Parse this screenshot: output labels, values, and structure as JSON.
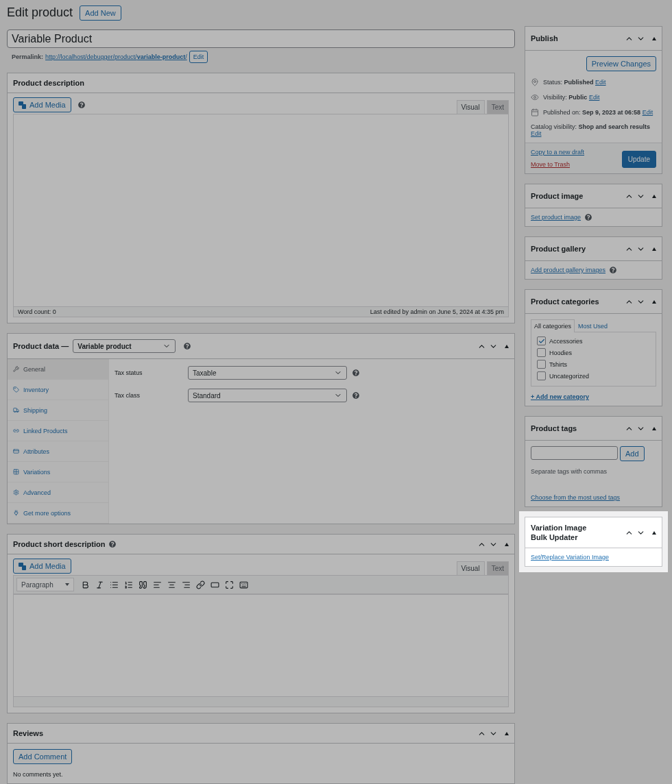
{
  "page": {
    "title": "Edit product",
    "add_new": "Add New"
  },
  "product_title": {
    "value": "Variable Product"
  },
  "permalink": {
    "label": "Permalink:",
    "url": "http://localhost/debugger/product/**variable-product**/",
    "edit": "Edit"
  },
  "description": {
    "title": "Product description",
    "add_media": "Add Media",
    "tabs": [
      {
        "label": "Visual",
        "selected": true
      },
      {
        "label": "Text",
        "selected": false
      }
    ],
    "word_count": "Word count: 0",
    "last_edited": "Last edited by admin on June 5, 2024 at 4:35 pm"
  },
  "product_data": {
    "title": "Product data —",
    "type": "Variable product",
    "nav": [
      {
        "kind": "general",
        "label": "General",
        "selected": true
      },
      {
        "kind": "inventory",
        "label": "Inventory",
        "selected": false
      },
      {
        "kind": "shipping",
        "label": "Shipping",
        "selected": false
      },
      {
        "kind": "linked",
        "label": "Linked Products",
        "selected": false
      },
      {
        "kind": "attributes",
        "label": "Attributes",
        "selected": false
      },
      {
        "kind": "variations",
        "label": "Variations",
        "selected": false
      },
      {
        "kind": "advanced",
        "label": "Advanced",
        "selected": false
      },
      {
        "kind": "more",
        "label": "Get more options",
        "selected": false
      }
    ],
    "fields": [
      {
        "label": "Tax status",
        "value": "Taxable"
      },
      {
        "label": "Tax class",
        "value": "Standard"
      }
    ]
  },
  "short_description": {
    "title": "Product short description",
    "add_media": "Add Media",
    "tabs": [
      {
        "label": "Visual",
        "selected": true
      },
      {
        "label": "Text",
        "selected": false
      }
    ],
    "format": "Paragraph"
  },
  "reviews": {
    "title": "Reviews",
    "button": "Add Comment",
    "empty": "No comments yet."
  },
  "sidebar": [
    {
      "kind": "publish",
      "title": "Publish",
      "highlighted": false,
      "preview": "Preview Changes",
      "rows": [
        {
          "kind": "status",
          "text": "Status: **Published**",
          "edit": "Edit"
        },
        {
          "kind": "visibility",
          "text": "Visibility: **Public**",
          "edit": "Edit"
        },
        {
          "kind": "date",
          "text": "Published on: **Sep 9, 2023 at 06:58**",
          "edit": "Edit"
        },
        {
          "kind": "catalog",
          "text": "Catalog visibility: **Shop and search results**",
          "edit": "Edit"
        }
      ],
      "copy": "Copy to a new draft",
      "trash": "Move to Trash",
      "update": "Update"
    },
    {
      "kind": "image",
      "title": "Product image",
      "highlighted": false,
      "link": "Set product image"
    },
    {
      "kind": "gallery",
      "title": "Product gallery",
      "highlighted": false,
      "link": "Add product gallery images"
    },
    {
      "kind": "categories",
      "title": "Product categories",
      "highlighted": false,
      "tabs": [
        {
          "label": "All categories",
          "selected": true
        },
        {
          "label": "Most Used",
          "selected": false
        }
      ],
      "items": [
        {
          "label": "Accessories",
          "checked": true
        },
        {
          "label": "Hoodies",
          "checked": false
        },
        {
          "label": "Tshirts",
          "checked": false
        },
        {
          "label": "Uncategorized",
          "checked": false
        }
      ],
      "add": "+ Add new category"
    },
    {
      "kind": "tags",
      "title": "Product tags",
      "highlighted": false,
      "button": "Add",
      "hint": "Separate tags with commas",
      "link": "Choose from the most used tags"
    },
    {
      "kind": "plugin",
      "title": "Variation Image Bulk Updater",
      "highlighted": true,
      "link": "Set/Replace Variation Image"
    }
  ]
}
